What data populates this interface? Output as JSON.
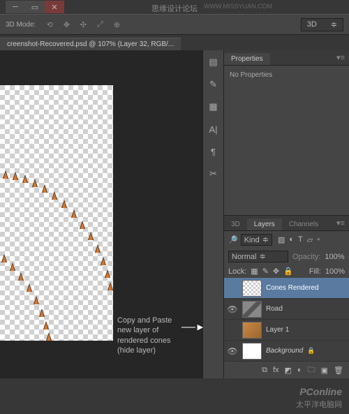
{
  "watermarks": {
    "top_center": "思缘设计论坛",
    "top_right": "WWW.MISSYUAN.COM",
    "bottom_brand": "PConline",
    "bottom_sub": "太平洋电脑网"
  },
  "toolbar": {
    "mode_label": "3D Mode:",
    "dropdown_value": "3D"
  },
  "document": {
    "tab_title": "creenshot-Recovered.psd @ 107% (Layer 32, RGB/..."
  },
  "annotation": {
    "line1": "Copy and Paste",
    "line2": "new layer of",
    "line3": "rendered cones",
    "line4": "(hide layer)"
  },
  "properties_panel": {
    "tab": "Properties",
    "body": "No Properties"
  },
  "layers_panel": {
    "tabs": [
      "3D",
      "Layers",
      "Channels"
    ],
    "filter_label": "Kind",
    "blend_mode": "Normal",
    "opacity_label": "Opacity:",
    "opacity_value": "100%",
    "lock_label": "Lock:",
    "fill_label": "Fill:",
    "fill_value": "100%",
    "layers": [
      {
        "name": "Cones Rendered",
        "selected": true,
        "visible": false,
        "thumb": "checker"
      },
      {
        "name": "Road",
        "selected": false,
        "visible": true,
        "thumb": "road"
      },
      {
        "name": "Layer 1",
        "selected": false,
        "visible": false,
        "thumb": "l1"
      },
      {
        "name": "Background",
        "selected": false,
        "visible": true,
        "thumb": "bg",
        "locked": true,
        "italic": true
      }
    ]
  }
}
